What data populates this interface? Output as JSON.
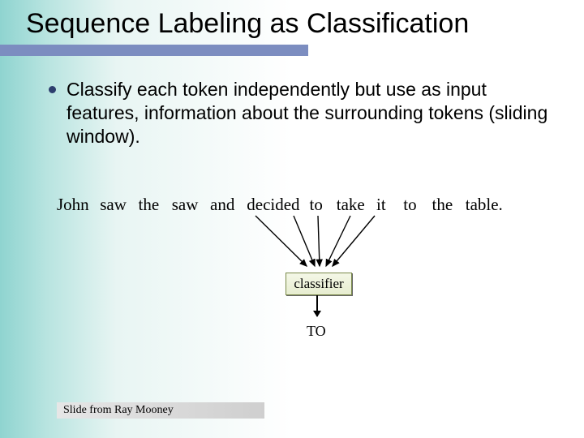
{
  "title": "Sequence Labeling as Classification",
  "bullet": "Classify each token independently but use as input features, information about the surrounding tokens (sliding window).",
  "sentence": [
    "John",
    "saw",
    "the",
    "saw",
    "and",
    "decided",
    "to",
    "take",
    "it",
    "to",
    "the",
    "table."
  ],
  "classifier_label": "classifier",
  "output_tag": "TO",
  "credit": "Slide from Ray Mooney",
  "colors": {
    "rule": "#7c8dc0",
    "bullet": "#2d3e6e",
    "box_border": "#7a8a4a"
  }
}
